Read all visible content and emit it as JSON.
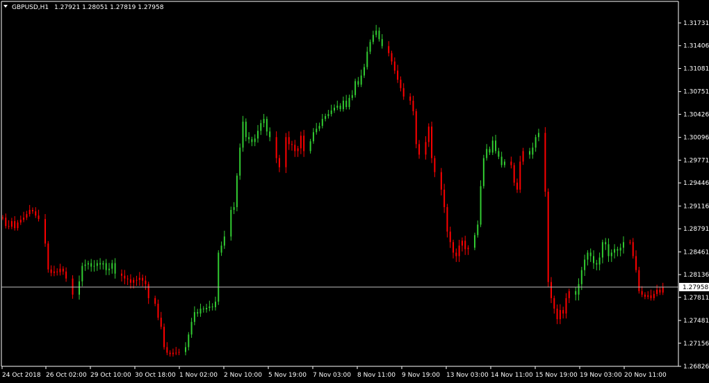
{
  "header": {
    "symbol_label": "GBPUSD,H1",
    "ohlc_label": "1.27921 1.28051 1.27819 1.27958",
    "dropdown_icon": "triangle-down-icon"
  },
  "colors": {
    "background": "#000000",
    "axis": "#ffffff",
    "bull": "#32CD32",
    "bear": "#FF0000",
    "price_line": "#c0c0c0",
    "price_label_bg": "#ffffff",
    "price_label_text": "#000000"
  },
  "chart_data": {
    "type": "candlestick",
    "title": "GBPUSD,H1",
    "ylim": [
      1.2679,
      1.31845
    ],
    "y_ticks": [
      "1.31731",
      "1.31406",
      "1.31081",
      "1.30751",
      "1.30426",
      "1.30096",
      "1.29771",
      "1.29446",
      "1.29116",
      "1.28791",
      "1.28461",
      "1.28136",
      "1.27811",
      "1.27481",
      "1.27156",
      "1.26826"
    ],
    "x_ticks": [
      "24 Oct 2018",
      "26 Oct 02:00",
      "29 Oct 10:00",
      "30 Oct 18:00",
      "1 Nov 02:00",
      "2 Nov 10:00",
      "5 Nov 19:00",
      "7 Nov 03:00",
      "8 Nov 11:00",
      "9 Nov 19:00",
      "13 Nov 03:00",
      "14 Nov 11:00",
      "15 Nov 19:00",
      "19 Nov 03:00",
      "20 Nov 11:00"
    ],
    "current_price": "1.27958",
    "series": [
      {
        "segments": [
          {
            "dir": "bear",
            "values": [
              1.2895,
              1.2883,
              1.2882,
              1.289,
              1.288,
              1.2888,
              1.2892,
              1.2895,
              1.29,
              1.2906,
              1.2904,
              1.2898,
              1.2893
            ]
          },
          {
            "dir": "bear",
            "values": [
              1.2858,
              1.2821,
              1.2816,
              1.2818,
              1.2817,
              1.2822,
              1.2818,
              1.2808
            ]
          },
          {
            "dir": "bear",
            "values": [
              1.2785
            ]
          },
          {
            "dir": "bull",
            "values": [
              1.2804,
              1.2826,
              1.2828,
              1.283,
              1.2825,
              1.2826,
              1.283,
              1.2828,
              1.283,
              1.282,
              1.2822,
              1.283,
              1.2815
            ]
          },
          {
            "dir": "bear",
            "values": [
              1.2812,
              1.2808,
              1.2807,
              1.2802,
              1.2806,
              1.2806,
              1.2809,
              1.2805,
              1.28,
              1.278
            ]
          },
          {
            "dir": "bear",
            "values": [
              1.2772,
              1.2752,
              1.2739,
              1.271,
              1.2702,
              1.27,
              1.2702,
              1.2702,
              1.2703
            ]
          },
          {
            "dir": "bull",
            "values": [
              1.271,
              1.2728,
              1.2746,
              1.276,
              1.2758,
              1.2765,
              1.2764,
              1.2766,
              1.2768,
              1.2767,
              1.2775,
              1.2845,
              1.2855,
              1.2868
            ]
          },
          {
            "dir": "bull",
            "values": [
              1.2906,
              1.291,
              1.2955,
              1.2995,
              1.3032,
              1.301,
              1.3007,
              1.3003,
              1.3008,
              1.3019,
              1.303,
              1.3036,
              1.3018,
              1.301
            ]
          },
          {
            "dir": "bear",
            "values": [
              1.298,
              1.2967
            ]
          },
          {
            "dir": "bear",
            "values": [
              1.301,
              1.3,
              1.2999,
              1.299,
              1.2994,
              1.3012,
              1.299
            ]
          },
          {
            "dir": "bull",
            "values": [
              1.3004,
              1.3017,
              1.3022,
              1.3026,
              1.3036,
              1.304,
              1.3043,
              1.3048,
              1.3052,
              1.3055,
              1.305,
              1.3062,
              1.3053,
              1.3066,
              1.307,
              1.309,
              1.3085,
              1.3098,
              1.311,
              1.3132,
              1.3146,
              1.3156,
              1.3162,
              1.315,
              1.314
            ]
          },
          {
            "dir": "bear",
            "values": [
              1.313,
              1.3118,
              1.3105,
              1.3092,
              1.308,
              1.3068
            ]
          },
          {
            "dir": "bear",
            "values": [
              1.3062,
              1.3047,
              1.3,
              1.2985
            ]
          },
          {
            "dir": "bear",
            "values": [
              1.3003,
              1.3025,
              1.298,
              1.296
            ]
          },
          {
            "dir": "bear",
            "values": [
              1.2935,
              1.291,
              1.2875,
              1.286,
              1.2845,
              1.284,
              1.2855,
              1.2862,
              1.285,
              1.2852
            ]
          },
          {
            "dir": "bull",
            "values": [
              1.287,
              1.2885,
              1.294,
              1.298,
              1.2993,
              1.2988,
              1.3005,
              1.299,
              1.2982,
              1.297,
              1.2975
            ]
          },
          {
            "dir": "bear",
            "values": [
              1.297,
              1.2945,
              1.2935,
              1.2975,
              1.299
            ]
          },
          {
            "dir": "bull",
            "values": [
              1.2985,
              1.2995,
              1.301,
              1.3016
            ]
          },
          {
            "dir": "bear",
            "values": [
              1.2932,
              1.2803,
              1.278,
              1.2765,
              1.275,
              1.2763,
              1.2758,
              1.278,
              1.279
            ]
          },
          {
            "dir": "bull",
            "values": [
              1.2785,
              1.28,
              1.282,
              1.2835,
              1.2845,
              1.284,
              1.283,
              1.2828,
              1.2838,
              1.286,
              1.2857,
              1.284,
              1.2845,
              1.285,
              1.2848,
              1.2852,
              1.286
            ]
          },
          {
            "dir": "bear",
            "values": [
              1.286,
              1.284,
              1.282,
              1.279,
              1.2785,
              1.2782,
              1.2784,
              1.278,
              1.2786,
              1.2792,
              1.2788,
              1.2796
            ]
          }
        ]
      }
    ]
  }
}
